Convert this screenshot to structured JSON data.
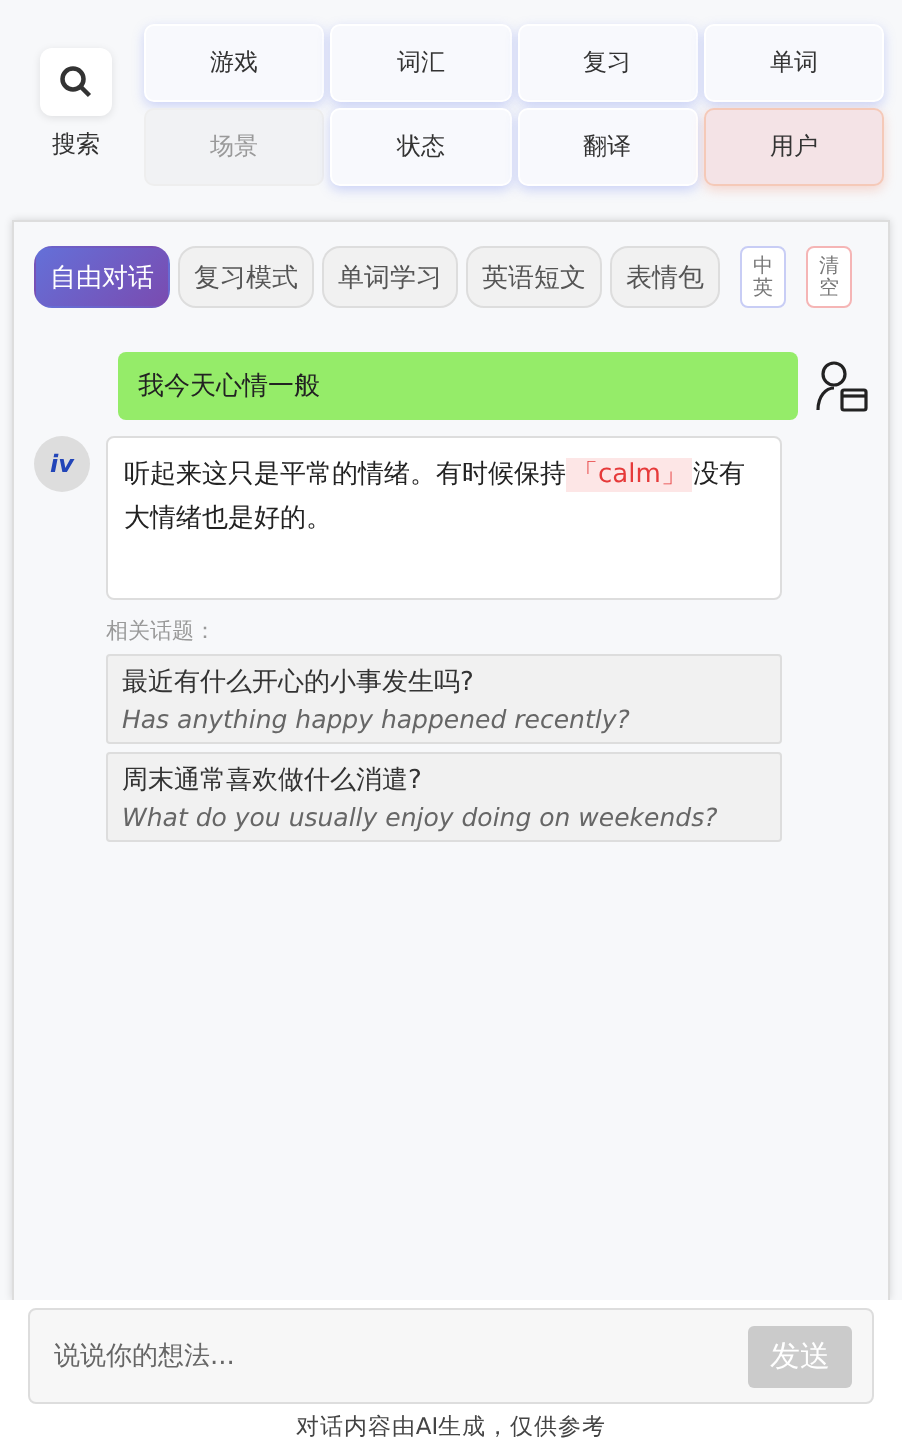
{
  "search": {
    "label": "搜索"
  },
  "nav_buttons": [
    {
      "label": "游戏",
      "disabled": false,
      "selected": false
    },
    {
      "label": "词汇",
      "disabled": false,
      "selected": false
    },
    {
      "label": "复习",
      "disabled": false,
      "selected": false
    },
    {
      "label": "单词",
      "disabled": false,
      "selected": false
    },
    {
      "label": "场景",
      "disabled": true,
      "selected": false
    },
    {
      "label": "状态",
      "disabled": false,
      "selected": false
    },
    {
      "label": "翻译",
      "disabled": false,
      "selected": false
    },
    {
      "label": "用户",
      "disabled": false,
      "selected": true
    }
  ],
  "mode_tabs": [
    {
      "label": "自由对话",
      "selected": true
    },
    {
      "label": "复习模式",
      "selected": false
    },
    {
      "label": "单词学习",
      "selected": false
    },
    {
      "label": "英语短文",
      "selected": false
    },
    {
      "label": "表情包",
      "selected": false
    }
  ],
  "lang_toggle": "中英",
  "clear_button": "清空",
  "messages": [
    {
      "kind": "user",
      "text": "我今天心情一般"
    },
    {
      "kind": "bot",
      "avatar": "iv",
      "text": "听起来这只是平常的情绪。有时候保持",
      "highlight": "「calm」",
      "text_after": "没有大情绪也是好的。"
    }
  ],
  "related": {
    "label": "相关话题：",
    "topics": [
      {
        "zh": "最近有什么开心的小事发生吗?",
        "en": "Has anything happy happened recently?"
      },
      {
        "zh": "周末通常喜欢做什么消遣?",
        "en": "What do you usually enjoy doing on weekends?"
      }
    ]
  },
  "input": {
    "placeholder": "说说你的想法...",
    "send": "发送",
    "send_disabled": true
  },
  "footer": "对话内容由AI生成，仅供参考"
}
